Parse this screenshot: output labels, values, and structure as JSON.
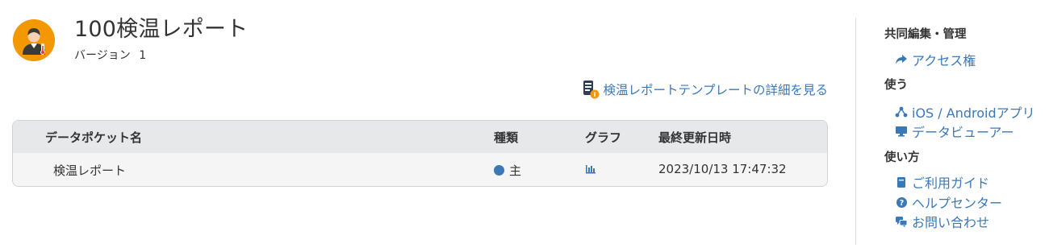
{
  "header": {
    "title": "100検温レポート",
    "version_label": "バージョン",
    "version_number": "1",
    "template_link_label": "検温レポートテンプレートの詳細を見る"
  },
  "table": {
    "columns": [
      "データポケット名",
      "種類",
      "グラフ",
      "最終更新日時"
    ],
    "rows": [
      {
        "name": "検温レポート",
        "type": "主",
        "updated": "2023/10/13 17:47:32"
      }
    ]
  },
  "sidebar": {
    "sections": [
      {
        "title": "共同編集・管理",
        "links": [
          {
            "label": "アクセス権",
            "icon": "share-arrow-icon"
          }
        ]
      },
      {
        "title": "使う",
        "links": [
          {
            "label": "iOS / Androidアプリ",
            "icon": "app-network-icon"
          },
          {
            "label": "データビューアー",
            "icon": "monitor-icon"
          }
        ]
      },
      {
        "title": "使い方",
        "links": [
          {
            "label": "ご利用ガイド",
            "icon": "book-icon"
          },
          {
            "label": "ヘルプセンター",
            "icon": "question-circle-icon"
          },
          {
            "label": "お問い合わせ",
            "icon": "chat-bubbles-icon"
          }
        ]
      }
    ]
  },
  "colors": {
    "accent": "#3a78b8",
    "app_icon_bg": "#f39800",
    "table_header_bg": "#e7e8ea",
    "table_row_bg": "#f5f5f5"
  }
}
